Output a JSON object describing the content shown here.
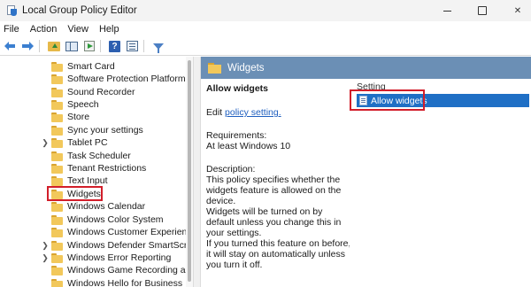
{
  "window": {
    "title": "Local Group Policy Editor"
  },
  "menu": [
    "File",
    "Action",
    "View",
    "Help"
  ],
  "toolbar": {
    "icons": [
      "back-arrow",
      "forward-arrow",
      "up-folder",
      "show-hide-tree",
      "export-list",
      "help",
      "properties",
      "filter"
    ]
  },
  "tree": {
    "items": [
      {
        "label": "Smart Card",
        "expandable": false
      },
      {
        "label": "Software Protection Platform",
        "expandable": false
      },
      {
        "label": "Sound Recorder",
        "expandable": false
      },
      {
        "label": "Speech",
        "expandable": false
      },
      {
        "label": "Store",
        "expandable": false
      },
      {
        "label": "Sync your settings",
        "expandable": false
      },
      {
        "label": "Tablet PC",
        "expandable": true
      },
      {
        "label": "Task Scheduler",
        "expandable": false
      },
      {
        "label": "Tenant Restrictions",
        "expandable": false
      },
      {
        "label": "Text Input",
        "expandable": false
      },
      {
        "label": "Widgets",
        "expandable": false,
        "selected": true
      },
      {
        "label": "Windows Calendar",
        "expandable": false
      },
      {
        "label": "Windows Color System",
        "expandable": false
      },
      {
        "label": "Windows Customer Experience Ir",
        "expandable": false
      },
      {
        "label": "Windows Defender SmartScreen",
        "expandable": true
      },
      {
        "label": "Windows Error Reporting",
        "expandable": true
      },
      {
        "label": "Windows Game Recording and B",
        "expandable": false
      },
      {
        "label": "Windows Hello for Business",
        "expandable": false
      }
    ]
  },
  "details": {
    "header_title": "Widgets",
    "policy_title": "Allow widgets",
    "edit_prefix": "Edit",
    "edit_link": "policy setting.",
    "requirements_label": "Requirements:",
    "requirements_value": "At least Windows 10",
    "description_label": "Description:",
    "description_text": "This policy specifies whether the widgets feature is allowed on the device.\nWidgets will be turned on by default unless you change this in your settings.\nIf you turned this feature on before, it will stay on automatically unless you turn it off."
  },
  "list": {
    "column_header": "Setting",
    "rows": [
      {
        "label": "Allow widgets",
        "selected": true
      }
    ]
  },
  "colors": {
    "header_bg": "#6b8fb5",
    "selection_bg": "#1f6fc5",
    "highlight_box": "#d21e2a",
    "link": "#1f5fbf"
  }
}
